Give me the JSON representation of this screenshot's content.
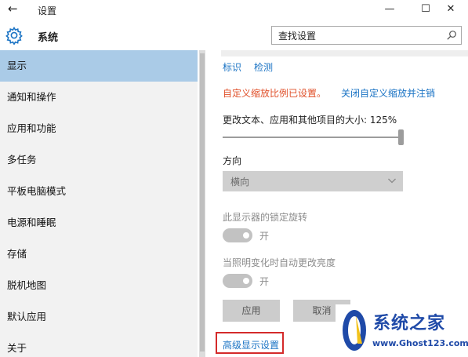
{
  "window": {
    "back_glyph": "←",
    "title": "设置",
    "minimize_glyph": "—",
    "maximize_glyph": "☐",
    "close_glyph": "✕"
  },
  "header": {
    "app_icon": "gear-icon",
    "app_name": "系统",
    "search_value": "查找设置",
    "search_icon": "search-icon"
  },
  "sidebar": {
    "active_color": "#aacbe7",
    "items": [
      {
        "label": "显示",
        "active": true
      },
      {
        "label": "通知和操作"
      },
      {
        "label": "应用和功能"
      },
      {
        "label": "多任务"
      },
      {
        "label": "平板电脑模式"
      },
      {
        "label": "电源和睡眠"
      },
      {
        "label": "存储"
      },
      {
        "label": "脱机地图"
      },
      {
        "label": "默认应用"
      },
      {
        "label": "关于"
      }
    ]
  },
  "main": {
    "identify_link": "标识",
    "detect_link": "检测",
    "custom_scale_warning": "自定义缩放比例已设置。",
    "custom_scale_off_link": "关闭自定义缩放并注销",
    "size_label": "更改文本、应用和其他项目的大小: 125%",
    "size_value_percent": 125,
    "orientation_label": "方向",
    "orientation_value": "横向",
    "orientation_chevron_icon": "chevron-down-icon",
    "lock_rotation_label": "此显示器的锁定旋转",
    "lock_rotation_state": "开",
    "auto_brightness_label": "当照明变化时自动更改亮度",
    "auto_brightness_state": "开",
    "apply_label": "应用",
    "cancel_label": "取消",
    "advanced_link": "高级显示设置",
    "accent_color": "#1a73c4",
    "warning_color": "#e0502a"
  },
  "watermark": {
    "brand": "系统之家",
    "url": "www.Ghost123.com"
  }
}
